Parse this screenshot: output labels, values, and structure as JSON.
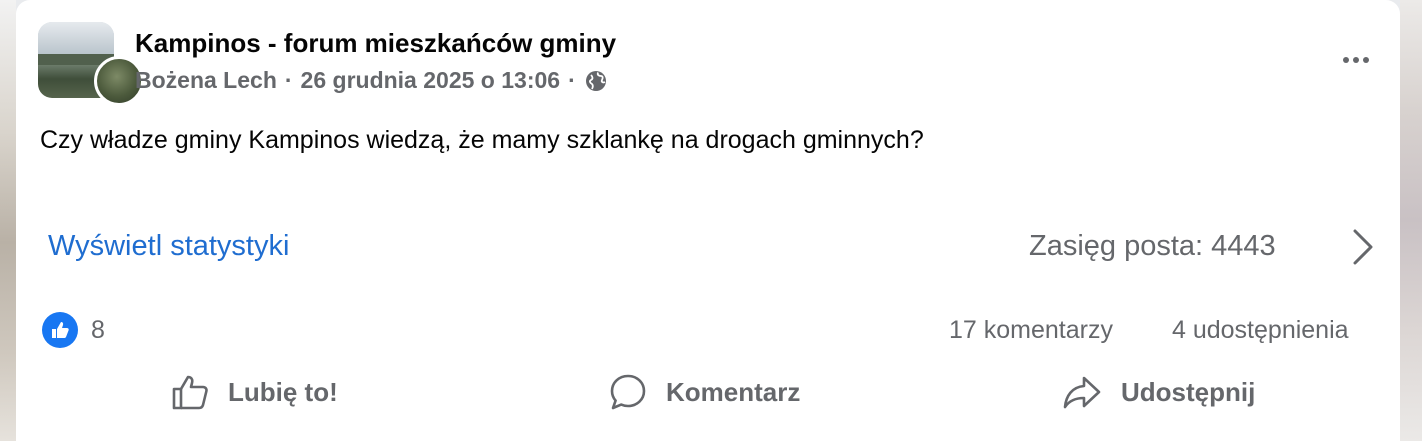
{
  "post": {
    "group_name": "Kampinos - forum mieszkańców gminy",
    "author": "Bożena Lech",
    "separator": "·",
    "timestamp": "26 grudnia 2025 o 13:06",
    "privacy_icon": "globe-icon",
    "body": "Czy władze gminy Kampinos wiedzą, że mamy szklankę na drogach gminnych?"
  },
  "insights": {
    "stats_link": "Wyświetl statystyki",
    "reach_label": "Zasięg posta: 4443",
    "chevron_icon": "chevron-right-icon"
  },
  "engagement": {
    "like_icon": "like-badge-icon",
    "like_count": "8",
    "comments": "17 komentarzy",
    "shares": "4 udostępnienia"
  },
  "actions": {
    "like_label": "Lubię to!",
    "comment_label": "Komentarz",
    "share_label": "Udostępnij"
  },
  "colors": {
    "link_blue": "#1f6dd0",
    "secondary_text": "#65676b",
    "like_blue": "#1877f2"
  }
}
